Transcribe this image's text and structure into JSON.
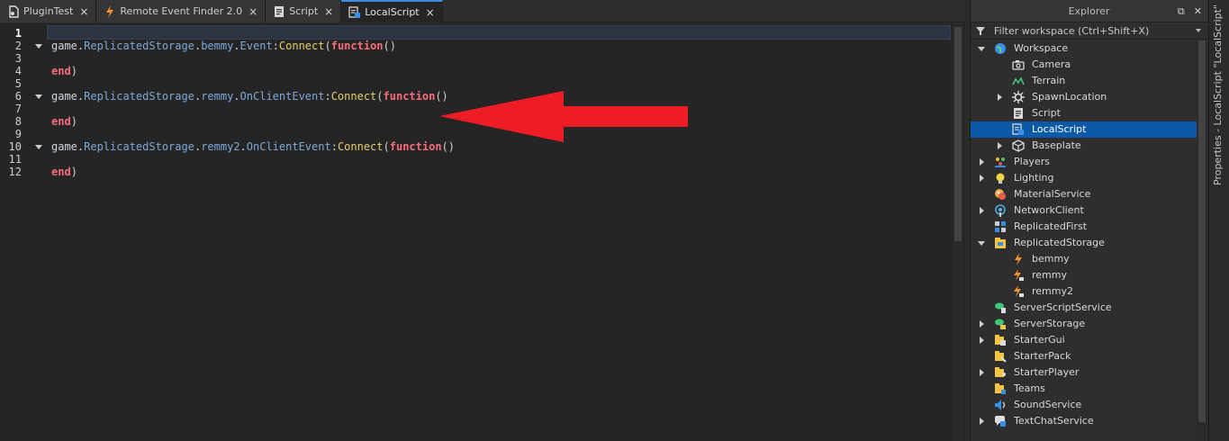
{
  "tabs": [
    {
      "label": "PluginTest",
      "icon": "plugin-icon",
      "active": false
    },
    {
      "label": "Remote Event Finder 2.0",
      "icon": "lightning-icon",
      "active": false
    },
    {
      "label": "Script",
      "icon": "script-icon",
      "active": false
    },
    {
      "label": "LocalScript",
      "icon": "localscript-icon",
      "active": true
    }
  ],
  "tab_close_glyph": "×",
  "editor": {
    "line_numbers": [
      "1",
      "2",
      "3",
      "4",
      "5",
      "6",
      "7",
      "8",
      "9",
      "10",
      "11",
      "12"
    ],
    "lines": [
      {
        "n": 2,
        "tokens": [
          {
            "t": "game.",
            "c": "plain"
          },
          {
            "t": "ReplicatedStorage",
            "c": "prop"
          },
          {
            "t": ".",
            "c": "plain"
          },
          {
            "t": "bemmy",
            "c": "prop"
          },
          {
            "t": ".",
            "c": "plain"
          },
          {
            "t": "Event",
            "c": "prop"
          },
          {
            "t": ":",
            "c": "plain"
          },
          {
            "t": "Connect",
            "c": "method"
          },
          {
            "t": "(",
            "c": "punc"
          },
          {
            "t": "function",
            "c": "kw"
          },
          {
            "t": "()",
            "c": "punc"
          }
        ]
      },
      {
        "n": 4,
        "tokens": [
          {
            "t": "end",
            "c": "kw"
          },
          {
            "t": ")",
            "c": "punc"
          }
        ]
      },
      {
        "n": 6,
        "tokens": [
          {
            "t": "game.",
            "c": "plain"
          },
          {
            "t": "ReplicatedStorage",
            "c": "prop"
          },
          {
            "t": ".",
            "c": "plain"
          },
          {
            "t": "remmy",
            "c": "prop"
          },
          {
            "t": ".",
            "c": "plain"
          },
          {
            "t": "OnClientEvent",
            "c": "prop"
          },
          {
            "t": ":",
            "c": "plain"
          },
          {
            "t": "Connect",
            "c": "method"
          },
          {
            "t": "(",
            "c": "punc"
          },
          {
            "t": "function",
            "c": "kw"
          },
          {
            "t": "()",
            "c": "punc"
          }
        ]
      },
      {
        "n": 8,
        "tokens": [
          {
            "t": "end",
            "c": "kw"
          },
          {
            "t": ")",
            "c": "punc"
          }
        ]
      },
      {
        "n": 10,
        "tokens": [
          {
            "t": "game.",
            "c": "plain"
          },
          {
            "t": "ReplicatedStorage",
            "c": "prop"
          },
          {
            "t": ".",
            "c": "plain"
          },
          {
            "t": "remmy2",
            "c": "prop"
          },
          {
            "t": ".",
            "c": "plain"
          },
          {
            "t": "OnClientEvent",
            "c": "prop"
          },
          {
            "t": ":",
            "c": "plain"
          },
          {
            "t": "Connect",
            "c": "method"
          },
          {
            "t": "(",
            "c": "punc"
          },
          {
            "t": "function",
            "c": "kw"
          },
          {
            "t": "()",
            "c": "punc"
          }
        ]
      },
      {
        "n": 12,
        "tokens": [
          {
            "t": "end",
            "c": "kw"
          },
          {
            "t": ")",
            "c": "punc"
          }
        ]
      }
    ],
    "fold_lines": [
      2,
      6,
      10
    ],
    "current_line": 1,
    "annotation_arrow_color": "#ee1c25"
  },
  "explorer": {
    "title": "Explorer",
    "filter_placeholder": "Filter workspace (Ctrl+Shift+X)",
    "items": [
      {
        "label": "Workspace",
        "icon": "workspace-icon",
        "depth": 0,
        "expander": "down"
      },
      {
        "label": "Camera",
        "icon": "camera-icon",
        "depth": 1,
        "expander": ""
      },
      {
        "label": "Terrain",
        "icon": "terrain-icon",
        "depth": 1,
        "expander": ""
      },
      {
        "label": "SpawnLocation",
        "icon": "spawn-icon",
        "depth": 1,
        "expander": "right"
      },
      {
        "label": "Script",
        "icon": "script-icon",
        "depth": 1,
        "expander": ""
      },
      {
        "label": "LocalScript",
        "icon": "localscript-icon",
        "depth": 1,
        "expander": "",
        "selected": true
      },
      {
        "label": "Baseplate",
        "icon": "part-icon",
        "depth": 1,
        "expander": "right"
      },
      {
        "label": "Players",
        "icon": "players-icon",
        "depth": 0,
        "expander": "right"
      },
      {
        "label": "Lighting",
        "icon": "lighting-icon",
        "depth": 0,
        "expander": "right"
      },
      {
        "label": "MaterialService",
        "icon": "material-icon",
        "depth": 0,
        "expander": ""
      },
      {
        "label": "NetworkClient",
        "icon": "network-icon",
        "depth": 0,
        "expander": "right"
      },
      {
        "label": "ReplicatedFirst",
        "icon": "replicated-first-icon",
        "depth": 0,
        "expander": ""
      },
      {
        "label": "ReplicatedStorage",
        "icon": "replicated-storage-icon",
        "depth": 0,
        "expander": "down"
      },
      {
        "label": "bemmy",
        "icon": "bindable-event-icon",
        "depth": 1,
        "expander": ""
      },
      {
        "label": "remmy",
        "icon": "remote-event-icon",
        "depth": 1,
        "expander": ""
      },
      {
        "label": "remmy2",
        "icon": "remote-event-icon",
        "depth": 1,
        "expander": ""
      },
      {
        "label": "ServerScriptService",
        "icon": "server-script-service-icon",
        "depth": 0,
        "expander": ""
      },
      {
        "label": "ServerStorage",
        "icon": "server-storage-icon",
        "depth": 0,
        "expander": "right"
      },
      {
        "label": "StarterGui",
        "icon": "starter-gui-icon",
        "depth": 0,
        "expander": "right"
      },
      {
        "label": "StarterPack",
        "icon": "starter-pack-icon",
        "depth": 0,
        "expander": ""
      },
      {
        "label": "StarterPlayer",
        "icon": "starter-player-icon",
        "depth": 0,
        "expander": "right"
      },
      {
        "label": "Teams",
        "icon": "teams-icon",
        "depth": 0,
        "expander": ""
      },
      {
        "label": "SoundService",
        "icon": "sound-icon",
        "depth": 0,
        "expander": ""
      },
      {
        "label": "TextChatService",
        "icon": "text-chat-icon",
        "depth": 0,
        "expander": "right"
      }
    ]
  },
  "side_panel": {
    "label": "Properties - LocalScript \"LocalScript\""
  },
  "colors": {
    "selection": "#0b5aa8",
    "keyword": "#f86d7c",
    "property": "#7fa8d8",
    "method": "#e5cf6f"
  }
}
